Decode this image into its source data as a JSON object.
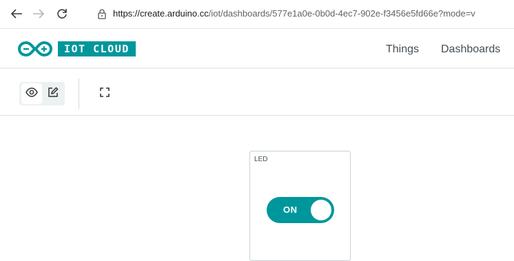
{
  "browser": {
    "url_host": "https://create.arduino.cc",
    "url_path": "/iot/dashboards/577e1a0e-0b0d-4ec7-902e-f3456e5fd66e?mode=v"
  },
  "header": {
    "brand": "IOT CLOUD",
    "nav": [
      {
        "label": "Things"
      },
      {
        "label": "Dashboards"
      }
    ]
  },
  "toolbar": {
    "active_mode": "view"
  },
  "widgets": [
    {
      "title": "LED",
      "type": "switch",
      "state_label": "ON",
      "state": true
    }
  ],
  "colors": {
    "brand_teal": "#00979c",
    "mode_group_bg": "#ecf1f1",
    "text": "#434f54"
  },
  "icons": {
    "back": "arrow-left-icon",
    "forward": "arrow-right-icon",
    "reload": "reload-icon",
    "lock": "lock-icon",
    "logo": "arduino-infinity-logo",
    "view": "eye-icon",
    "edit": "edit-icon",
    "fullscreen": "fullscreen-icon"
  }
}
